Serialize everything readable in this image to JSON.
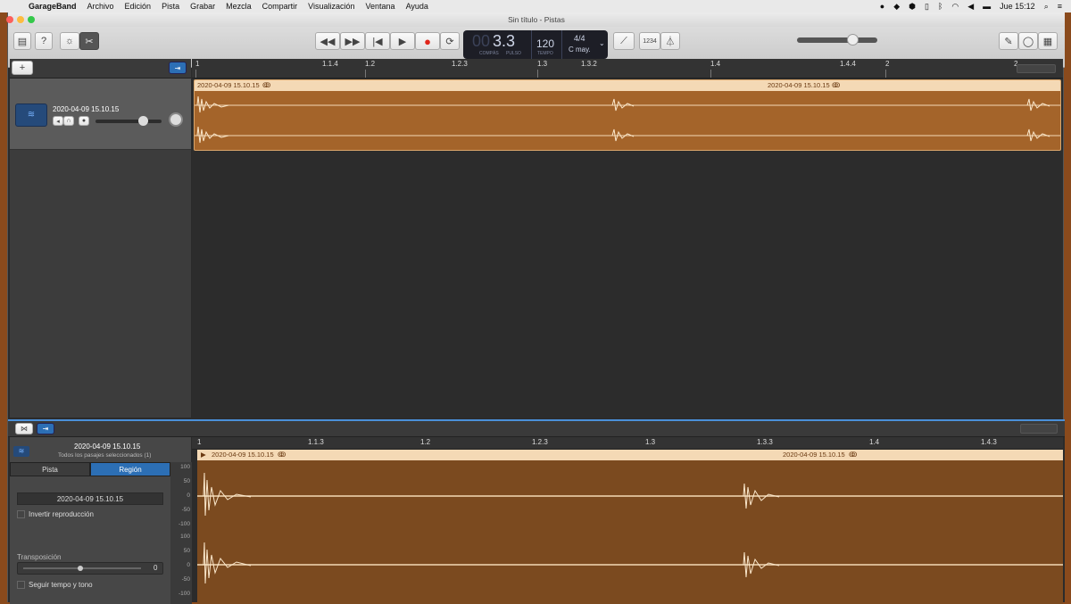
{
  "menubar": {
    "items": [
      "GarageBand",
      "Archivo",
      "Edición",
      "Pista",
      "Grabar",
      "Mezcla",
      "Compartir",
      "Visualización",
      "Ventana",
      "Ayuda"
    ],
    "clock": "Jue 15:12"
  },
  "window": {
    "title": "Sin título - Pistas"
  },
  "lcd": {
    "position_dim": "00",
    "position": "3.3",
    "label_bar": "COMPÁS",
    "label_beat": "PULSO",
    "tempo": "120",
    "label_tempo": "TEMPO",
    "signature": "4/4",
    "key": "C may.",
    "countin": "1234"
  },
  "ruler": {
    "ticks": [
      "1",
      "1.1.4",
      "1.2",
      "1.2.3",
      "1.3",
      "1.3.2",
      "1.4",
      "1.4.4",
      "2",
      "2"
    ]
  },
  "track": {
    "name": "2020-04-09 15.10.15"
  },
  "region": {
    "name": "2020-04-09 15.10.15",
    "name2": "2020-04-09 15.10.15"
  },
  "editor": {
    "title": "2020-04-09 15.10.15",
    "subtitle": "Todos los pasajes seleccionados (1)",
    "tab_track": "Pista",
    "tab_region": "Región",
    "region_field": "2020-04-09 15.10.15",
    "reverse_label": "Invertir reproducción",
    "transpose_label": "Transposición",
    "transpose_value": "0",
    "follow_label": "Seguir tempo y tono",
    "ruler_ticks": [
      "1",
      "1.1.3",
      "1.2",
      "1.2.3",
      "1.3",
      "1.3.3",
      "1.4",
      "1.4.3"
    ],
    "scale": [
      "100",
      "50",
      "0",
      "-50",
      "-100",
      "100",
      "50",
      "0",
      "-50",
      "-100"
    ],
    "region_name": "2020-04-09 15.10.15",
    "region_name2": "2020-04-09 15.10.15"
  }
}
